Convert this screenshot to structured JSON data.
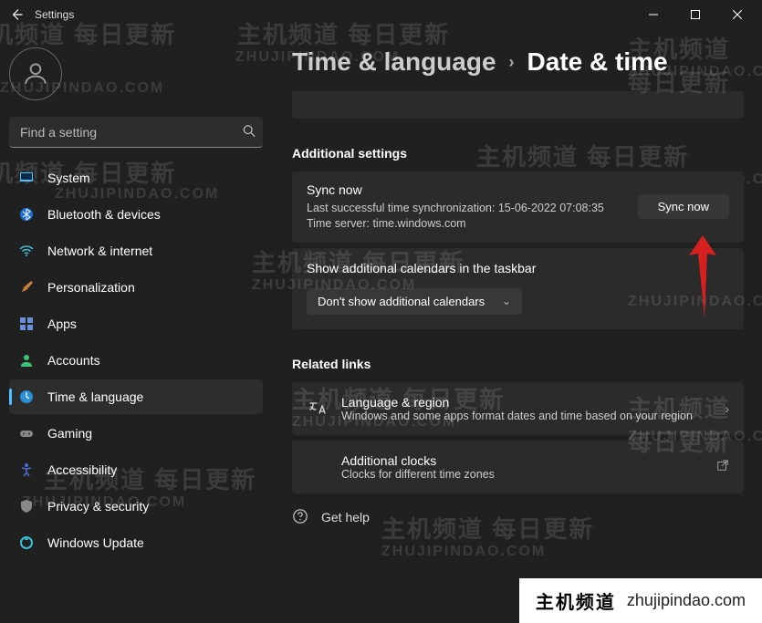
{
  "window": {
    "title": "Settings"
  },
  "search": {
    "placeholder": "Find a setting"
  },
  "nav": {
    "items": [
      {
        "label": "System"
      },
      {
        "label": "Bluetooth & devices"
      },
      {
        "label": "Network & internet"
      },
      {
        "label": "Personalization"
      },
      {
        "label": "Apps"
      },
      {
        "label": "Accounts"
      },
      {
        "label": "Time & language"
      },
      {
        "label": "Gaming"
      },
      {
        "label": "Accessibility"
      },
      {
        "label": "Privacy & security"
      },
      {
        "label": "Windows Update"
      }
    ],
    "active_index": 6
  },
  "breadcrumb": {
    "parent": "Time & language",
    "current": "Date & time"
  },
  "additional_settings": {
    "heading": "Additional settings",
    "sync": {
      "title": "Sync now",
      "line1": "Last successful time synchronization: 15-06-2022 07:08:35",
      "line2": "Time server: time.windows.com",
      "button_label": "Sync now"
    },
    "calendars": {
      "title": "Show additional calendars in the taskbar",
      "selected": "Don't show additional calendars"
    }
  },
  "related_links": {
    "heading": "Related links",
    "items": [
      {
        "title": "Language & region",
        "sub": "Windows and some apps format dates and time based on your region"
      },
      {
        "title": "Additional clocks",
        "sub": "Clocks for different time zones"
      }
    ]
  },
  "gethelp": {
    "label": "Get help"
  },
  "watermark": {
    "cn": "主机频道 每日更新",
    "en": "ZHUJIPINDAO.COM"
  },
  "footer": {
    "cn": "主机频道",
    "en": "zhujipindao.com"
  }
}
